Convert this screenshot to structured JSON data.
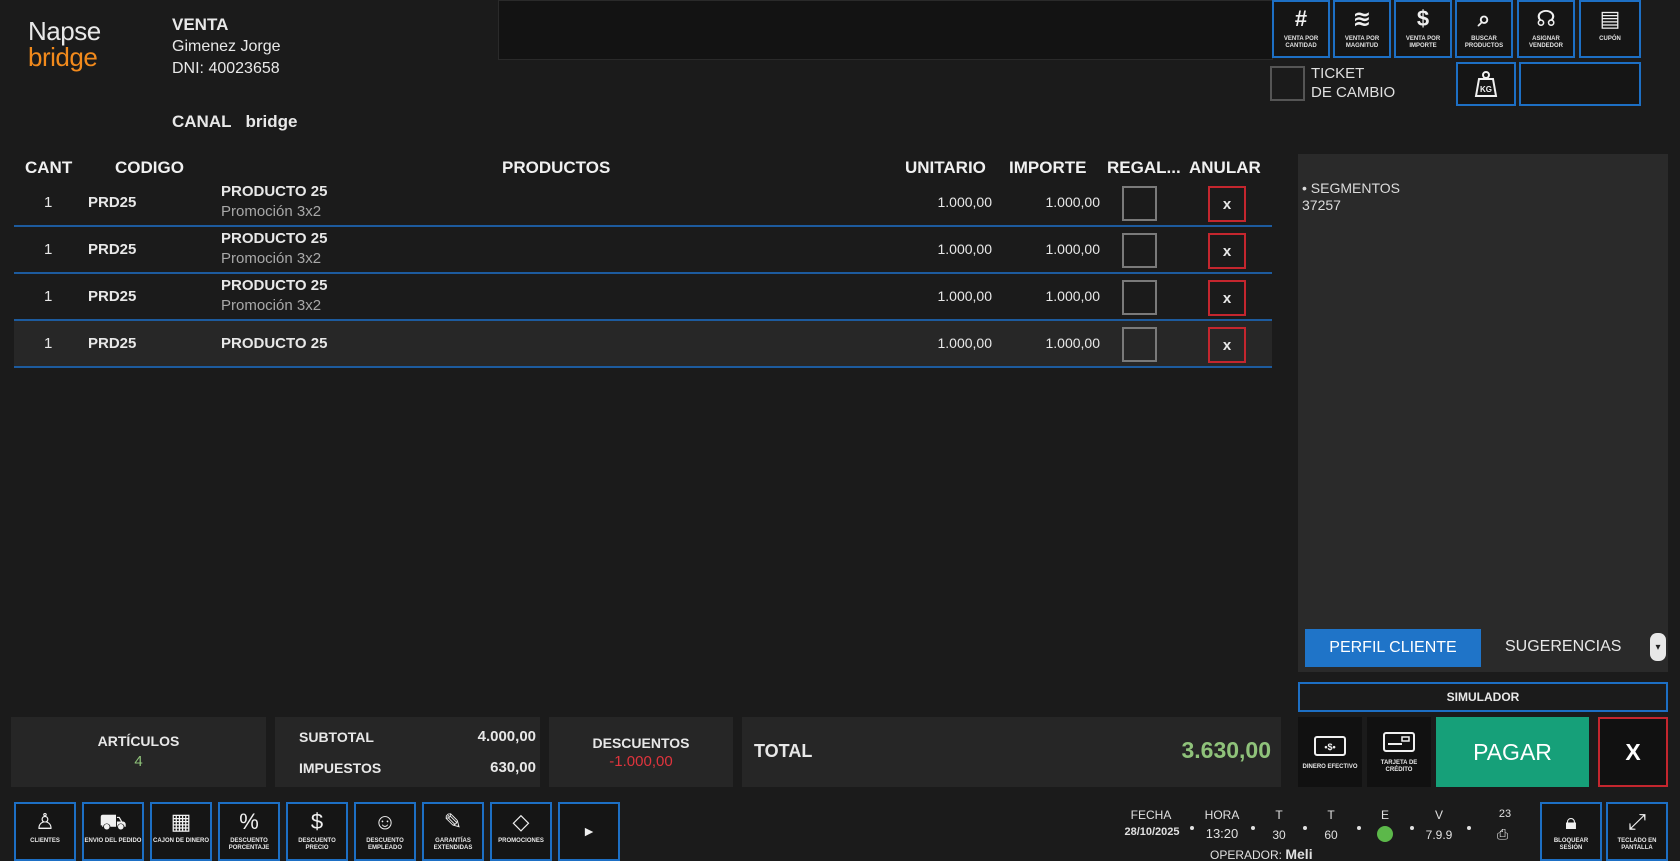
{
  "brand": {
    "line1": "Napse",
    "line2": "bridge"
  },
  "customer": {
    "title": "VENTA",
    "name": "Gimenez Jorge",
    "dni": "DNI: 40023658"
  },
  "canal": {
    "label": "CANAL",
    "value": "bridge"
  },
  "functions": [
    {
      "icon": "#",
      "label": "VENTA POR CANTIDAD"
    },
    {
      "icon": "≋",
      "label": "VENTA POR MAGNITUD"
    },
    {
      "icon": "$",
      "label": "VENTA POR IMPORTE"
    },
    {
      "icon": "⌕",
      "label": "BUSCAR PRODUCTOS"
    },
    {
      "icon": "☊",
      "label": "ASIGNAR VENDEDOR"
    },
    {
      "icon": "▤",
      "label": "CUPÓN"
    }
  ],
  "ticket": {
    "line1": "TICKET",
    "line2": "DE CAMBIO"
  },
  "kg": "KG",
  "table": {
    "headers": {
      "cant": "CANT",
      "codigo": "CODIGO",
      "productos": "PRODUCTOS",
      "unitario": "UNITARIO",
      "importe": "IMPORTE",
      "regalo": "REGAL...",
      "anular": "ANULAR"
    },
    "rows": [
      {
        "qty": "1",
        "code": "PRD25",
        "name": "PRODUCTO 25",
        "note": "Promoción 3x2",
        "unit": "1.000,00",
        "amount": "1.000,00",
        "void": "x"
      },
      {
        "qty": "1",
        "code": "PRD25",
        "name": "PRODUCTO 25",
        "note": "Promoción 3x2",
        "unit": "1.000,00",
        "amount": "1.000,00",
        "void": "x"
      },
      {
        "qty": "1",
        "code": "PRD25",
        "name": "PRODUCTO 25",
        "note": "Promoción 3x2",
        "unit": "1.000,00",
        "amount": "1.000,00",
        "void": "x"
      },
      {
        "qty": "1",
        "code": "PRD25",
        "name": "PRODUCTO 25",
        "note": "",
        "unit": "1.000,00",
        "amount": "1.000,00",
        "void": "x"
      }
    ]
  },
  "panel": {
    "seg_title": "• SEGMENTOS",
    "seg_value": "37257",
    "tab_perfil": "PERFIL CLIENTE",
    "tab_sug": "SUGERENCIAS",
    "simulador": "SIMULADOR"
  },
  "totals": {
    "articulos_label": "ARTÍCULOS",
    "articulos_value": "4",
    "subtotal_label": "SUBTOTAL",
    "subtotal_value": "4.000,00",
    "impuestos_label": "IMPUESTOS",
    "impuestos_value": "630,00",
    "descuentos_label": "DESCUENTOS",
    "descuentos_value": "-1.000,00",
    "total_label": "TOTAL",
    "total_value": "3.630,00"
  },
  "payment": {
    "cash_label": "DINERO EFECTIVO",
    "card_label": "TARJETA DE CRÉDITO",
    "pagar": "PAGAR",
    "cancel": "X"
  },
  "bottom_buttons": [
    {
      "icon": "♙",
      "label": "CLIENTES"
    },
    {
      "icon": "⛟",
      "label": "ENVIO DEL PEDIDO"
    },
    {
      "icon": "▦",
      "label": "CAJON DE DINERO"
    },
    {
      "icon": "%",
      "label": "DESCUENTO PORCENTAJE"
    },
    {
      "icon": "$",
      "label": "DESCUENTO PRECIO"
    },
    {
      "icon": "☺",
      "label": "DESCUENTO EMPLEADO"
    },
    {
      "icon": "✎",
      "label": "GARANTÍAS EXTENDIDAS"
    },
    {
      "icon": "◇",
      "label": "PROMOCIONES"
    }
  ],
  "next_icon": "►",
  "status": {
    "fecha_label": "FECHA",
    "fecha_value": "28/10/2025",
    "hora_label": "HORA",
    "hora_value": "13:20",
    "t1_label": "T",
    "t1_value": "30",
    "t2_label": "T",
    "t2_value": "60",
    "e_label": "E",
    "v_label": "V",
    "v_value": "7.9.9",
    "n_label": "23",
    "operador_label": "OPERADOR:",
    "operador_value": "Meli"
  },
  "lock_label": "BLOQUEAR SESIÓN",
  "keyboard_label": "TECLADO EN PANTALLA",
  "colors": {
    "accent": "#1d6fc4",
    "danger": "#c4262e",
    "success": "#16a079",
    "total_green": "#8fc27a",
    "brand_orange": "#f28a1c"
  }
}
